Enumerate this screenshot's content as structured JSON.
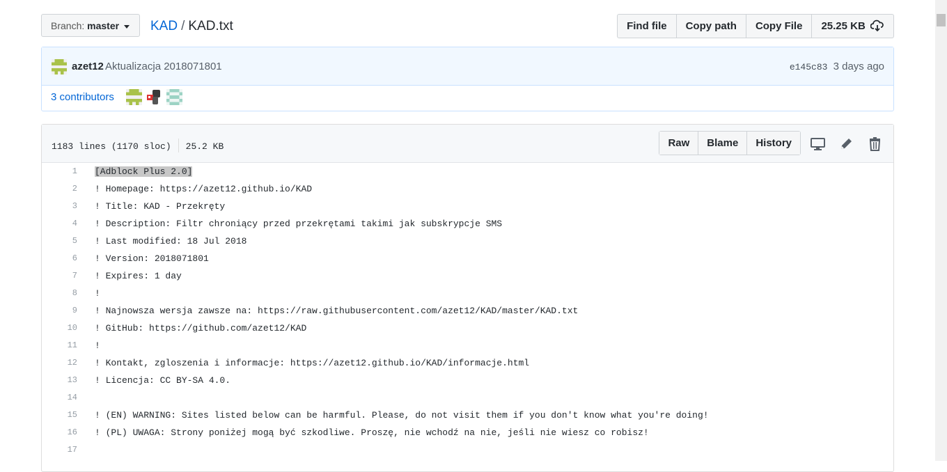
{
  "topbar": {
    "branch_label": "Branch:",
    "branch_name": "master",
    "breadcrumb_repo": "KAD",
    "breadcrumb_sep": "/",
    "breadcrumb_file": "KAD.txt",
    "find_file": "Find file",
    "copy_path": "Copy path",
    "copy_file": "Copy File",
    "file_size": "25.25 KB"
  },
  "commit": {
    "author": "azet12",
    "message": "Aktualizacja 2018071801",
    "sha": "e145c83",
    "time": "3 days ago",
    "contributors_count": "3",
    "contributors_label": "contributors"
  },
  "file": {
    "lines_info": "1183 lines (1170 sloc)",
    "size": "25.2 KB",
    "raw": "Raw",
    "blame": "Blame",
    "history": "History"
  },
  "code_lines": [
    {
      "n": "1",
      "t": "[Adblock Plus 2.0]"
    },
    {
      "n": "2",
      "t": "! Homepage: https://azet12.github.io/KAD"
    },
    {
      "n": "3",
      "t": "! Title: KAD - Przekręty"
    },
    {
      "n": "4",
      "t": "! Description: Filtr chroniący przed przekrętami takimi jak subskrypcje SMS"
    },
    {
      "n": "5",
      "t": "! Last modified: 18 Jul 2018"
    },
    {
      "n": "6",
      "t": "! Version: 2018071801"
    },
    {
      "n": "7",
      "t": "! Expires: 1 day"
    },
    {
      "n": "8",
      "t": "!"
    },
    {
      "n": "9",
      "t": "! Najnowsza wersja zawsze na: https://raw.githubusercontent.com/azet12/KAD/master/KAD.txt"
    },
    {
      "n": "10",
      "t": "! GitHub: https://github.com/azet12/KAD"
    },
    {
      "n": "11",
      "t": "!"
    },
    {
      "n": "12",
      "t": "! Kontakt, zgloszenia i informacje: https://azet12.github.io/KAD/informacje.html"
    },
    {
      "n": "13",
      "t": "! Licencja: CC BY-SA 4.0."
    },
    {
      "n": "14",
      "t": ""
    },
    {
      "n": "15",
      "t": "! (EN) WARNING: Sites listed below can be harmful. Please, do not visit them if you don't know what you're doing!"
    },
    {
      "n": "16",
      "t": "! (PL) UWAGA: Strony poniżej mogą być szkodliwe. Proszę, nie wchodź na nie, jeśli nie wiesz co robisz!"
    },
    {
      "n": "17",
      "t": ""
    }
  ]
}
